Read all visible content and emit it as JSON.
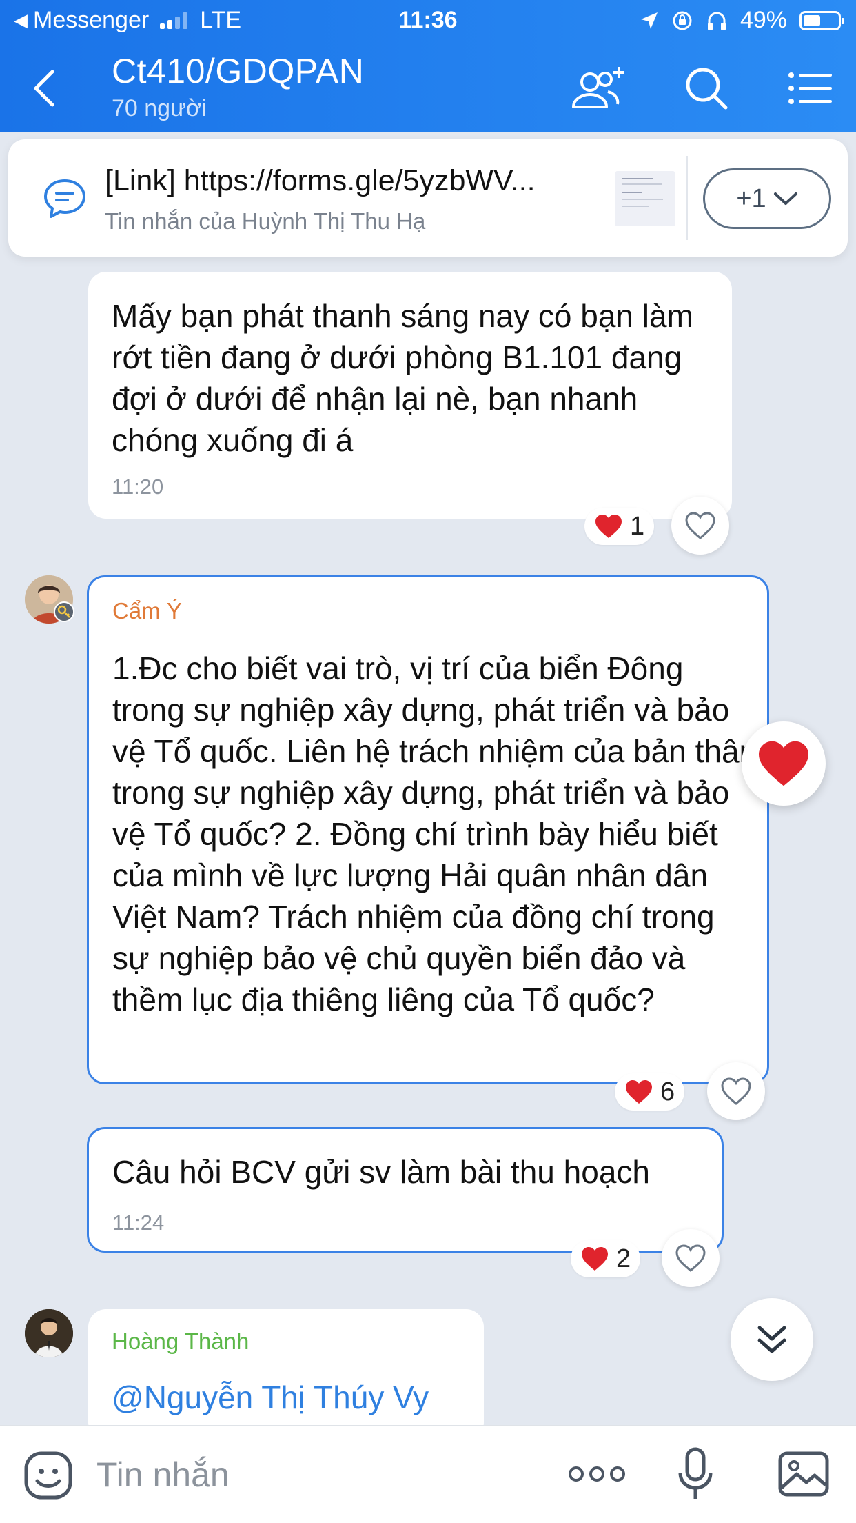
{
  "status_bar": {
    "back_app": "Messenger",
    "network": "LTE",
    "time": "11:36",
    "battery": "49%"
  },
  "header": {
    "title": "Ct410/GDQPAN",
    "subtitle": "70 người",
    "icons": [
      "back-arrow-icon",
      "add-member-icon",
      "search-icon",
      "menu-icon"
    ]
  },
  "pinned": {
    "title": "[Link] https://forms.gle/5yzbWV...",
    "subtitle": "Tin nhắn của Huỳnh Thị Thu Hạ",
    "more_label": "+1"
  },
  "messages": [
    {
      "text": "Mấy bạn phát thanh sáng nay có bạn làm rớt tiền đang ở dưới phòng B1.101 đang đợi ở dưới để nhận lại nè, bạn nhanh chóng xuống đi á",
      "time": "11:20",
      "reaction_count": "1"
    },
    {
      "sender": "Cẩm Ý",
      "sender_color": "#e07a38",
      "text": "1.Đc cho biết vai trò, vị trí của biển Đông trong sự nghiệp xây dựng, phát triển và bảo vệ Tổ quốc. Liên hệ trách nhiệm của bản thân trong sự nghiệp xây dựng, phát triển và bảo vệ Tổ quốc? 2. Đồng chí trình bày hiểu biết của mình về lực lượng Hải quân nhân dân Việt Nam? Trách nhiệm của đồng chí trong sự nghiệp bảo vệ chủ quyền biển đảo và thềm lục địa thiêng liêng của Tổ quốc?",
      "reaction_count": "6"
    },
    {
      "text": "Câu hỏi BCV gửi sv làm bài thu hoạch",
      "time": "11:24",
      "reaction_count": "2"
    },
    {
      "sender": "Hoàng Thành",
      "sender_color": "#5bb748",
      "mention": "@Nguyễn Thị Thúy Vy"
    }
  ],
  "input": {
    "placeholder": "Tin nhắn"
  },
  "colors": {
    "header": "#1a73e8",
    "selected_border": "#3b82e6",
    "heart": "#e0242d",
    "mention": "#2f80e0"
  }
}
